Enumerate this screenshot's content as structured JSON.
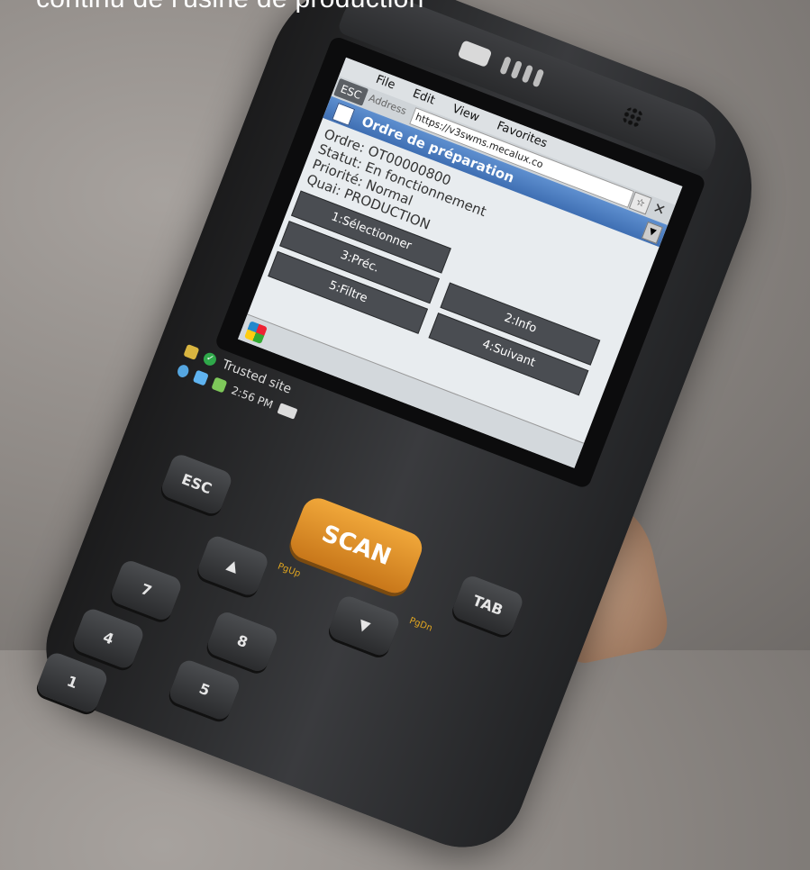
{
  "caption": "continu de l'usine de production",
  "device": {
    "menu": [
      "File",
      "Edit",
      "View",
      "Favorites"
    ],
    "esc_label": "ESC",
    "address_label": "Address",
    "address_value": "https://v3swms.mecalux.co",
    "title": "Ordre de préparation",
    "info_lines": [
      "Ordre: OT00000800",
      "Statut: En fonctionnement",
      "Priorité: Normal",
      "Quai: PRODUCTION"
    ],
    "buttons": [
      "1:Sélectionner",
      "",
      "3:Préc.",
      "2:Info",
      "5:Filtre",
      "4:Suivant"
    ],
    "status_text": "Trusted site",
    "time": "2:56 PM"
  },
  "keypad": {
    "esc": "ESC",
    "scan": "SCAN",
    "tab": "TAB",
    "pgup": "PgUp",
    "pgdn": "PgDn",
    "keys": [
      "7",
      "4",
      "1",
      "8",
      "5"
    ]
  }
}
